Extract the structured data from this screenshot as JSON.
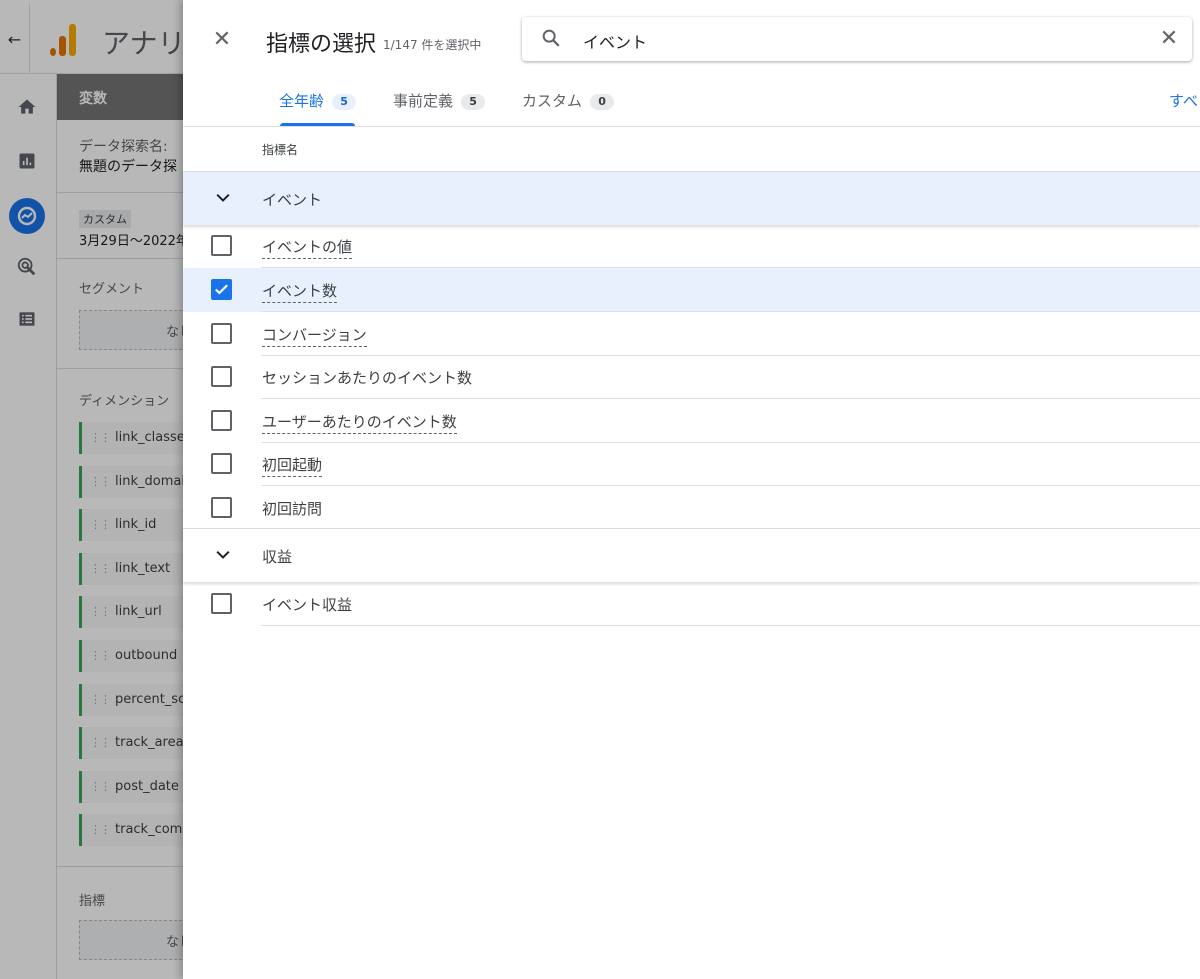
{
  "app": {
    "back_icon": "arrow-back-icon",
    "title": "アナリテ"
  },
  "leftnav": [
    "home-icon",
    "reports-icon",
    "explore-icon",
    "advertising-icon",
    "configure-icon"
  ],
  "variables": {
    "header": "変数",
    "exploration_name_label": "データ探索名:",
    "exploration_name_value": "無題のデータ探",
    "date_chip": "カスタム",
    "date_range": "3月29日～2022年",
    "segments_label": "セグメント",
    "segments_empty": "なし",
    "dimensions_label": "ディメンション",
    "dimensions": [
      "link_classes",
      "link_domain",
      "link_id",
      "link_text",
      "link_url",
      "outbound",
      "percent_scroll",
      "track_area",
      "post_date",
      "track_component"
    ],
    "metrics_label": "指標",
    "metrics_empty": "なし"
  },
  "picker": {
    "title": "指標の選択",
    "selection_count": "1/147 件を選択中",
    "search_value": "イベント",
    "tabs": [
      {
        "label": "全年齢",
        "count": "5",
        "active": true
      },
      {
        "label": "事前定義",
        "count": "5",
        "active": false
      },
      {
        "label": "カスタム",
        "count": "0",
        "active": false
      }
    ],
    "select_all": "すべ",
    "column_header": "指標名",
    "groups": [
      {
        "label": "イベント",
        "expanded": true,
        "items": [
          {
            "label": "イベントの値",
            "checked": false,
            "tooltip": true
          },
          {
            "label": "イベント数",
            "checked": true,
            "tooltip": true
          },
          {
            "label": "コンバージョン",
            "checked": false,
            "tooltip": true
          },
          {
            "label": "セッションあたりのイベント数",
            "checked": false,
            "tooltip": false
          },
          {
            "label": "ユーザーあたりのイベント数",
            "checked": false,
            "tooltip": true
          },
          {
            "label": "初回起動",
            "checked": false,
            "tooltip": true
          },
          {
            "label": "初回訪問",
            "checked": false,
            "tooltip": false
          }
        ]
      },
      {
        "label": "収益",
        "expanded": true,
        "items": [
          {
            "label": "イベント収益",
            "checked": false,
            "tooltip": false
          }
        ]
      }
    ]
  },
  "colors": {
    "accent": "#1a73e8",
    "selected_row": "#e8f0fe",
    "dimension_chip_border": "#34a853"
  }
}
